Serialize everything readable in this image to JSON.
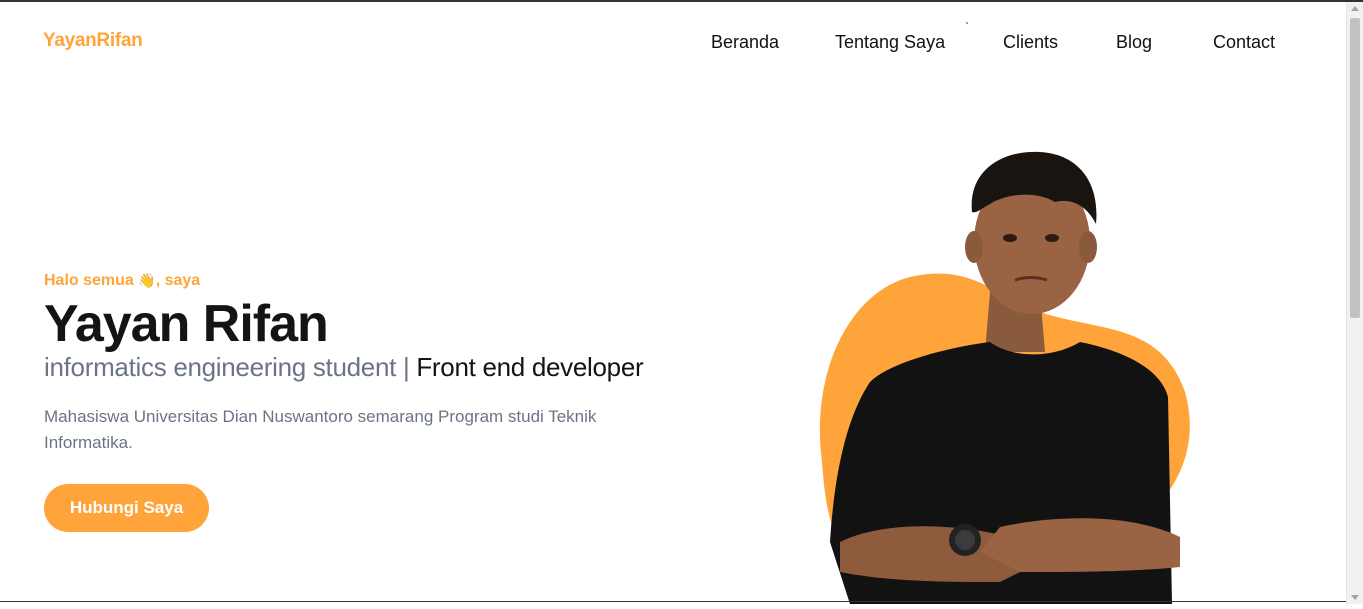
{
  "brand": {
    "logo": "YayanRifan",
    "accent_color": "#ffa43a"
  },
  "nav": {
    "items": [
      {
        "label": "Beranda"
      },
      {
        "label": "Tentang Saya"
      },
      {
        "label": "Clients"
      },
      {
        "label": "Blog"
      },
      {
        "label": "Contact"
      }
    ],
    "stray_mark": "`"
  },
  "hero": {
    "greeting_before": "Halo semua ",
    "greeting_emoji": "👋",
    "greeting_after": ", saya",
    "name": "Yayan Rifan",
    "role_primary": "informatics engineering student",
    "role_separator": " | ",
    "role_secondary": "Front end developer",
    "description": "Mahasiswa Universitas Dian Nuswantoro semarang Program studi Teknik Informatika.",
    "cta_label": "Hubungi Saya"
  },
  "photo": {
    "icon": "profile-photo",
    "blob_color": "#ffa43a",
    "shirt_color": "#111111"
  }
}
